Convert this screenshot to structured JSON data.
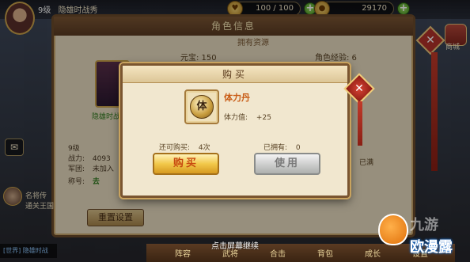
{
  "top_bar": {
    "level": "9级",
    "player_name": "隐雄时战秀",
    "stamina": "100 / 100",
    "gold": "29170"
  },
  "bag": {
    "label": "商城"
  },
  "char_panel": {
    "title": "角色信息",
    "section_title": "拥有资源",
    "res_yuanbao": "元宝: 150",
    "res_exp": "角色经验: 6",
    "portrait_name": "隐雄时战",
    "level": "9级",
    "stats": [
      {
        "key": "战力:",
        "value": "4093"
      },
      {
        "key": "军团:",
        "value": "未加入"
      },
      {
        "key": "称号:",
        "value": "去"
      }
    ],
    "side_full": "已满",
    "reset_label": "重置设置"
  },
  "side_ui": {
    "msg1": "名将传",
    "msg2": "通关王国",
    "chat_label": "[世界] 隐雄时战"
  },
  "bottom": {
    "hint": "点击屏幕继续",
    "menu": [
      "阵容",
      "武将",
      "合击",
      "背包",
      "成长",
      "设置"
    ]
  },
  "buy_dialog": {
    "title": "购买",
    "item_icon_char": "体",
    "item_name": "体力丹",
    "effect_label": "体力值:",
    "effect_value": "+25",
    "remaining_label": "还可购买:",
    "remaining_value": "4次",
    "owned_label": "已拥有:",
    "owned_value": "0",
    "buy_label": "购买",
    "use_label": "使用"
  },
  "watermark": {
    "line1": "九游",
    "line2": "欧漫露"
  },
  "colors": {
    "accent": "#c85a14",
    "buy_button": "#f2c84a",
    "use_button_disabled": "#cfd0cf",
    "close_red": "#d84434"
  }
}
